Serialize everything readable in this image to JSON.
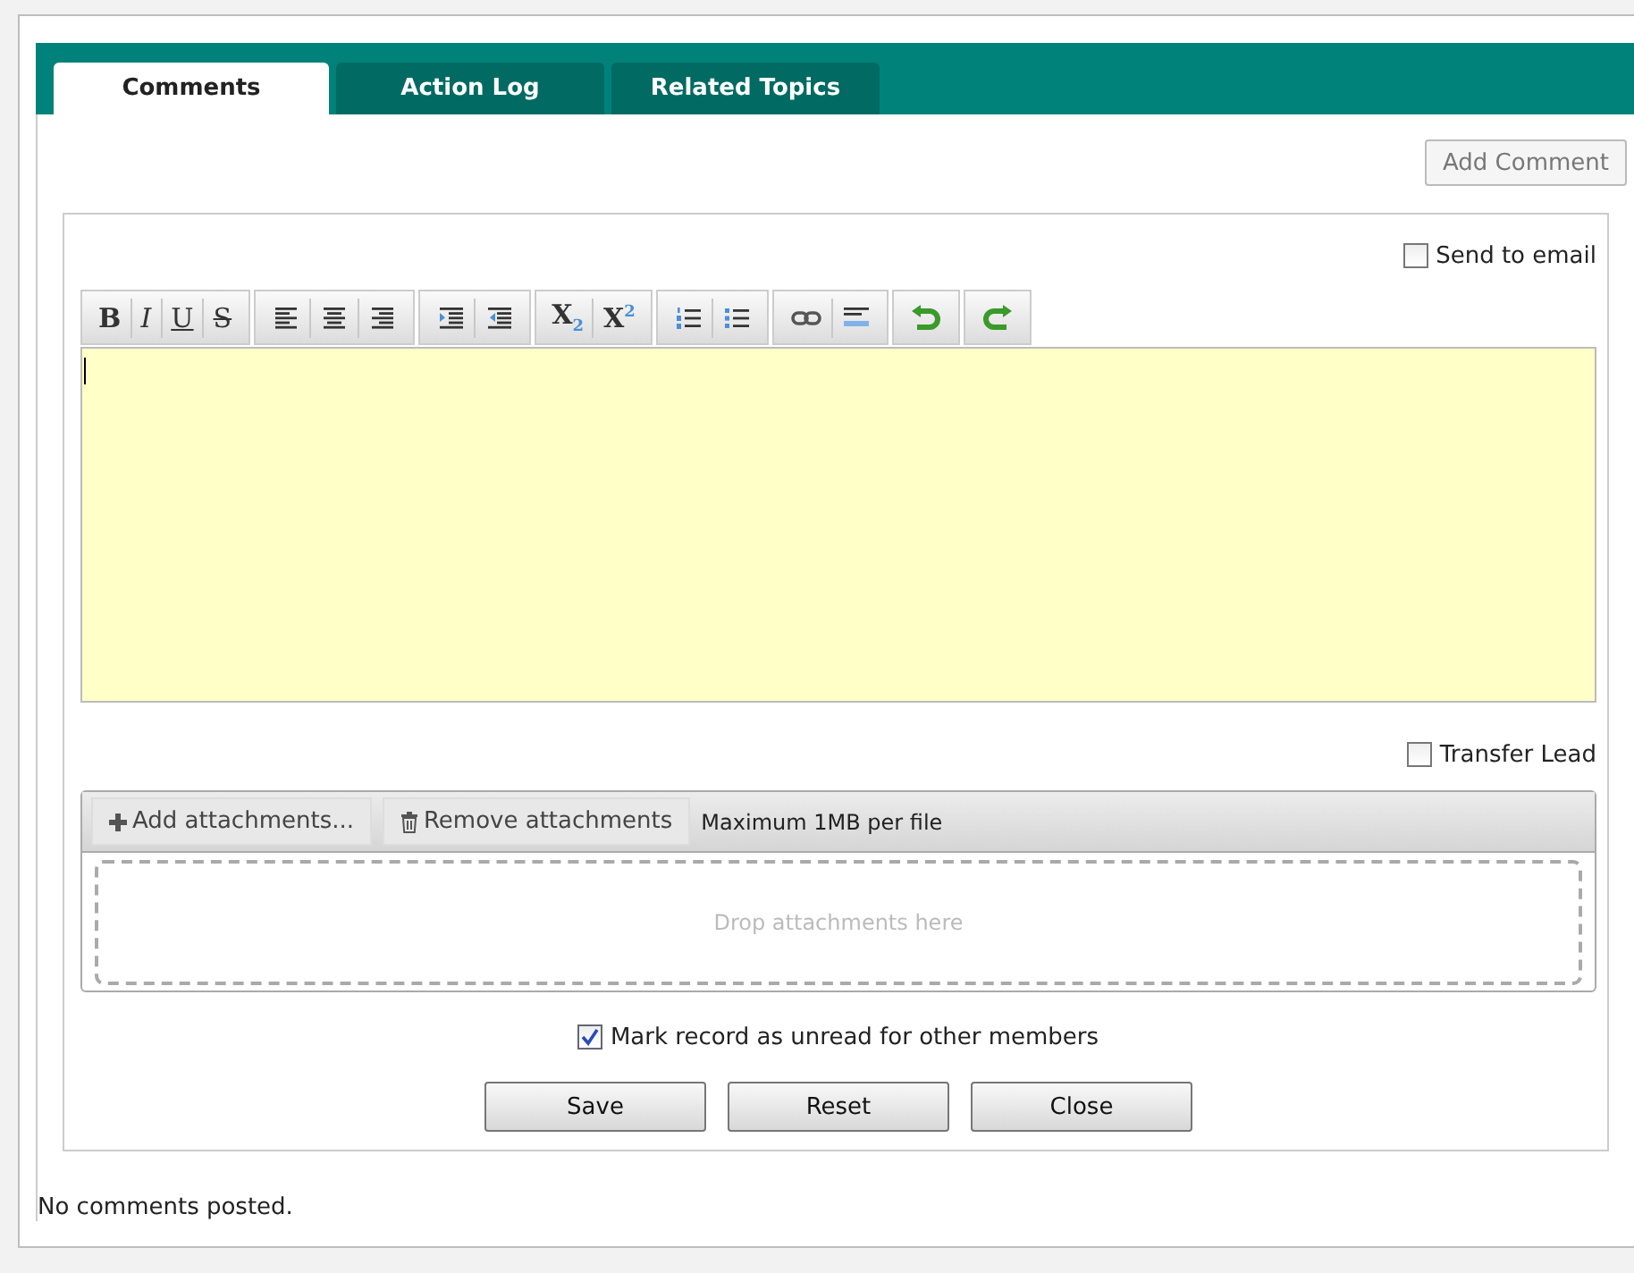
{
  "tabs": [
    {
      "label": "Comments",
      "selected": true
    },
    {
      "label": "Action Log",
      "selected": false
    },
    {
      "label": "Related Topics",
      "selected": false
    }
  ],
  "add_comment_button": "Add Comment",
  "send_to_email": {
    "label": "Send to email",
    "checked": false
  },
  "toolbar": [
    [
      {
        "kind": "bold",
        "label": "B"
      },
      {
        "kind": "italic",
        "label": "I"
      },
      {
        "kind": "underline",
        "label": "U"
      },
      {
        "kind": "strike",
        "label": "S"
      }
    ],
    [
      {
        "kind": "align-left"
      },
      {
        "kind": "align-center"
      },
      {
        "kind": "align-right"
      }
    ],
    [
      {
        "kind": "indent"
      },
      {
        "kind": "outdent"
      }
    ],
    [
      {
        "kind": "subscript",
        "label": "X$_{2}$"
      },
      {
        "kind": "superscript",
        "label": "X$^{2}$"
      }
    ],
    [
      {
        "kind": "ordered-list"
      },
      {
        "kind": "bullet-list"
      }
    ],
    [
      {
        "kind": "link"
      },
      {
        "kind": "rule"
      }
    ],
    [
      {
        "kind": "undo"
      }
    ],
    [
      {
        "kind": "redo"
      }
    ]
  ],
  "transfer_lead": {
    "label": "Transfer Lead",
    "checked": false
  },
  "attachments": {
    "add_button": "Add attachments...",
    "remove_button": "Remove attachments",
    "limit": "Maximum 1MB per file",
    "drop_placeholder": "Drop attachments here"
  },
  "mark_unread": {
    "label": "Mark record as unread for other members",
    "checked": true
  },
  "buttons": [
    "Save",
    "Reset",
    "Close"
  ],
  "empty_message": "No comments posted."
}
